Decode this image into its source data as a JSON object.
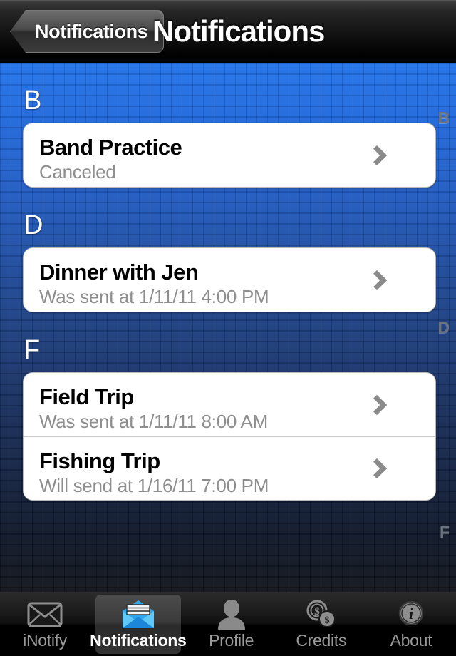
{
  "navbar": {
    "back_label": "Notifications",
    "title": "Notifications"
  },
  "list": {
    "sections": [
      {
        "header": "B",
        "index_letter": "B",
        "cells": [
          {
            "title": "Band Practice",
            "subtitle": "Canceled",
            "accessory": "chevron-right-icon"
          }
        ]
      },
      {
        "header": "D",
        "index_letter": "D",
        "cells": [
          {
            "title": "Dinner with Jen",
            "subtitle": "Was sent at 1/11/11 4:00 PM",
            "accessory": "chevron-right-icon"
          }
        ]
      },
      {
        "header": "F",
        "index_letter": "F",
        "cells": [
          {
            "title": "Field Trip",
            "subtitle": "Was sent at 1/11/11 8:00 AM",
            "accessory": "chevron-right-icon"
          },
          {
            "title": "Fishing Trip",
            "subtitle": "Will send at 1/16/11 7:00 PM",
            "accessory": "chevron-right-icon"
          }
        ]
      }
    ],
    "index_letters": [
      "B",
      "D",
      "F"
    ]
  },
  "tabbar": {
    "tabs": [
      {
        "label": "iNotify",
        "icon": "envelope-closed-icon",
        "selected": false
      },
      {
        "label": "Notifications",
        "icon": "envelope-open-icon",
        "selected": true
      },
      {
        "label": "Profile",
        "icon": "person-icon",
        "selected": false
      },
      {
        "label": "Credits",
        "icon": "dollar-coins-icon",
        "selected": false
      },
      {
        "label": "About",
        "icon": "info-circle-icon",
        "selected": false
      }
    ]
  },
  "colors": {
    "background_top": "#1b6ee8",
    "background_bottom": "#0a0d14",
    "cell_background": "#ffffff",
    "cell_title": "#000000",
    "cell_subtitle": "#8e8e8e",
    "accent_blue": "#35a9f0",
    "index_letter": "#6c7380",
    "navbar_text": "#ffffff"
  }
}
